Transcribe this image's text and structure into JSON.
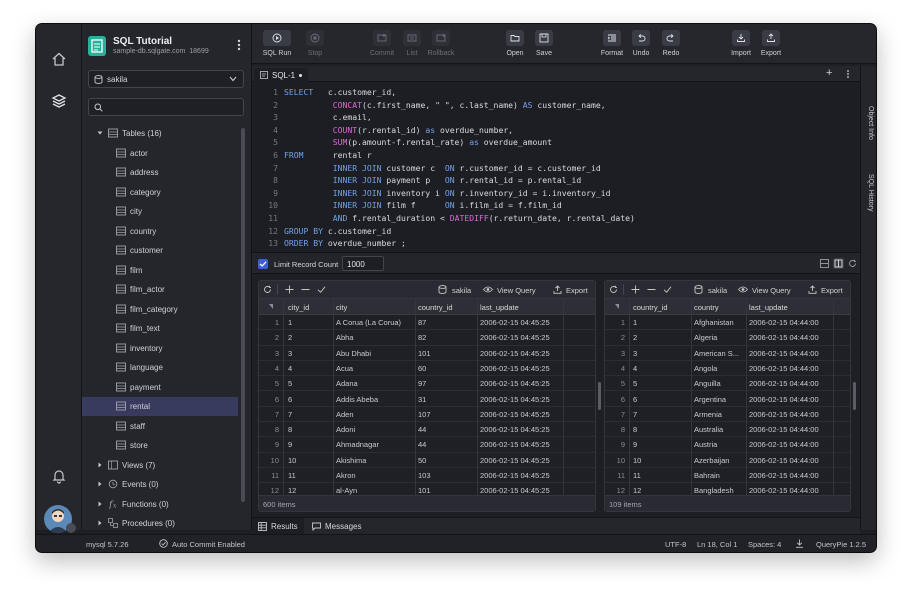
{
  "app": {
    "title": "SQL Tutorial",
    "host": "sample-db.sqlgate.com",
    "port": "18699",
    "database": "sakila"
  },
  "toolbar": [
    {
      "key": "run",
      "label": "SQL Run",
      "icon": "play-icon",
      "disabled": false
    },
    {
      "key": "stop",
      "label": "Stop",
      "icon": "stop-icon",
      "disabled": true
    },
    {
      "key": "commit",
      "label": "Commit",
      "icon": "commit-icon",
      "disabled": true
    },
    {
      "key": "list",
      "label": "List",
      "icon": "list-icon",
      "disabled": true
    },
    {
      "key": "rollback",
      "label": "Rollback",
      "icon": "rollback-icon",
      "disabled": true
    },
    {
      "key": "open",
      "label": "Open",
      "icon": "folder-icon",
      "disabled": false
    },
    {
      "key": "save",
      "label": "Save",
      "icon": "save-icon",
      "disabled": false
    },
    {
      "key": "format",
      "label": "Format",
      "icon": "format-icon",
      "disabled": false
    },
    {
      "key": "undo",
      "label": "Undo",
      "icon": "undo-icon",
      "disabled": false
    },
    {
      "key": "redo",
      "label": "Redo",
      "icon": "redo-icon",
      "disabled": false
    },
    {
      "key": "import",
      "label": "Import",
      "icon": "import-icon",
      "disabled": false
    },
    {
      "key": "export",
      "label": "Export",
      "icon": "export-icon",
      "disabled": false
    }
  ],
  "tree": {
    "tables_label": "Tables (16)",
    "tables": [
      "actor",
      "address",
      "category",
      "city",
      "country",
      "customer",
      "film",
      "film_actor",
      "film_category",
      "film_text",
      "inventory",
      "language",
      "payment",
      "rental",
      "staff",
      "store"
    ],
    "selected_table": "rental",
    "views_label": "Views (7)",
    "events_label": "Events (0)",
    "functions_label": "Functions (0)",
    "procedures_label": "Procedures (0)"
  },
  "editor": {
    "tab_label": "SQL-1",
    "lines": [
      [
        [
          "kw",
          "SELECT"
        ],
        [
          "t",
          "   c.customer_id,"
        ]
      ],
      [
        [
          "t",
          "          "
        ],
        [
          "fn",
          "CONCAT"
        ],
        [
          "t",
          "(c.first_name, \" \", c.last_name) "
        ],
        [
          "kw",
          "AS"
        ],
        [
          "t",
          " customer_name,"
        ]
      ],
      [
        [
          "t",
          "          c.email,"
        ]
      ],
      [
        [
          "t",
          "          "
        ],
        [
          "fn",
          "COUNT"
        ],
        [
          "t",
          "(r.rental_id) "
        ],
        [
          "kw",
          "as"
        ],
        [
          "t",
          " overdue_number,"
        ]
      ],
      [
        [
          "t",
          "          "
        ],
        [
          "fn",
          "SUM"
        ],
        [
          "t",
          "(p.amount-f.rental_rate) "
        ],
        [
          "kw",
          "as"
        ],
        [
          "t",
          " overdue_amount"
        ]
      ],
      [
        [
          "kw",
          "FROM"
        ],
        [
          "t",
          "      rental r"
        ]
      ],
      [
        [
          "t",
          "          "
        ],
        [
          "kw",
          "INNER JOIN"
        ],
        [
          "t",
          " customer c  "
        ],
        [
          "kw",
          "ON"
        ],
        [
          "t",
          " r.customer_id = c.customer_id"
        ]
      ],
      [
        [
          "t",
          "          "
        ],
        [
          "kw",
          "INNER JOIN"
        ],
        [
          "t",
          " payment p   "
        ],
        [
          "kw",
          "ON"
        ],
        [
          "t",
          " r.rental_id = p.rental_id"
        ]
      ],
      [
        [
          "t",
          "          "
        ],
        [
          "kw",
          "INNER JOIN"
        ],
        [
          "t",
          " inventory i "
        ],
        [
          "kw",
          "ON"
        ],
        [
          "t",
          " r.inventory_id = i.inventory_id"
        ]
      ],
      [
        [
          "t",
          "          "
        ],
        [
          "kw",
          "INNER JOIN"
        ],
        [
          "t",
          " film f      "
        ],
        [
          "kw",
          "ON"
        ],
        [
          "t",
          " i.film_id = f.film_id"
        ]
      ],
      [
        [
          "t",
          "          "
        ],
        [
          "kw",
          "AND"
        ],
        [
          "t",
          " f.rental_duration < "
        ],
        [
          "fn",
          "DATEDIFF"
        ],
        [
          "t",
          "(r.return_date, r.rental_date)"
        ]
      ],
      [
        [
          "kw",
          "GROUP BY"
        ],
        [
          "t",
          " c.customer_id"
        ]
      ],
      [
        [
          "kw",
          "ORDER BY"
        ],
        [
          "t",
          " overdue_number ;"
        ]
      ]
    ]
  },
  "side_panel": {
    "object_info": "Object Info",
    "sql_history": "SQL History"
  },
  "results": {
    "limit_label": "Limit Record Count",
    "limit_value": "1000",
    "grid1": {
      "db": "sakila",
      "view_query": "View Query",
      "export": "Export",
      "columns": [
        "city_id",
        "city",
        "country_id",
        "last_update"
      ],
      "rows": [
        [
          "1",
          "1",
          "A Corua (La Corua)",
          "87",
          "2006-02-15 04:45:25"
        ],
        [
          "2",
          "2",
          "Abha",
          "82",
          "2006-02-15 04:45:25"
        ],
        [
          "3",
          "3",
          "Abu Dhabi",
          "101",
          "2006-02-15 04:45:25"
        ],
        [
          "4",
          "4",
          "Acua",
          "60",
          "2006-02-15 04:45:25"
        ],
        [
          "5",
          "5",
          "Adana",
          "97",
          "2006-02-15 04:45:25"
        ],
        [
          "6",
          "6",
          "Addis Abeba",
          "31",
          "2006-02-15 04:45:25"
        ],
        [
          "7",
          "7",
          "Aden",
          "107",
          "2006-02-15 04:45:25"
        ],
        [
          "8",
          "8",
          "Adoni",
          "44",
          "2006-02-15 04:45:25"
        ],
        [
          "9",
          "9",
          "Ahmadnagar",
          "44",
          "2006-02-15 04:45:25"
        ],
        [
          "10",
          "10",
          "Akishima",
          "50",
          "2006-02-15 04:45:25"
        ],
        [
          "11",
          "11",
          "Akron",
          "103",
          "2006-02-15 04:45:25"
        ],
        [
          "12",
          "12",
          "al-Ayn",
          "101",
          "2006-02-15 04:45:25"
        ]
      ],
      "count": "600 items"
    },
    "grid2": {
      "db": "sakila",
      "view_query": "View Query",
      "export": "Export",
      "columns": [
        "country_id",
        "country",
        "last_update"
      ],
      "rows": [
        [
          "1",
          "1",
          "Afghanistan",
          "2006-02-15 04:44:00"
        ],
        [
          "2",
          "2",
          "Algeria",
          "2006-02-15 04:44:00"
        ],
        [
          "3",
          "3",
          "American S...",
          "2006-02-15 04:44:00"
        ],
        [
          "4",
          "4",
          "Angola",
          "2006-02-15 04:44:00"
        ],
        [
          "5",
          "5",
          "Anguilla",
          "2006-02-15 04:44:00"
        ],
        [
          "6",
          "6",
          "Argentina",
          "2006-02-15 04:44:00"
        ],
        [
          "7",
          "7",
          "Armenia",
          "2006-02-15 04:44:00"
        ],
        [
          "8",
          "8",
          "Australia",
          "2006-02-15 04:44:00"
        ],
        [
          "9",
          "9",
          "Austria",
          "2006-02-15 04:44:00"
        ],
        [
          "10",
          "10",
          "Azerbaijan",
          "2006-02-15 04:44:00"
        ],
        [
          "11",
          "11",
          "Bahrain",
          "2006-02-15 04:44:00"
        ],
        [
          "12",
          "12",
          "Bangladesh",
          "2006-02-15 04:44:00"
        ]
      ],
      "count": "109 items"
    },
    "tabs": [
      "Results",
      "Messages"
    ]
  },
  "status": {
    "engine": "mysql 5.7.26",
    "autocommit": "Auto Commit Enabled",
    "encoding": "UTF-8",
    "position": "Ln 18, Col 1",
    "spaces": "Spaces: 4",
    "version": "QueryPie 1.2.5"
  },
  "colors": {
    "accent": "#3b5fd6",
    "keyword": "#72a2e4",
    "function": "#d86bd4",
    "logo": "#27b19b",
    "selected": "#383a5e"
  }
}
